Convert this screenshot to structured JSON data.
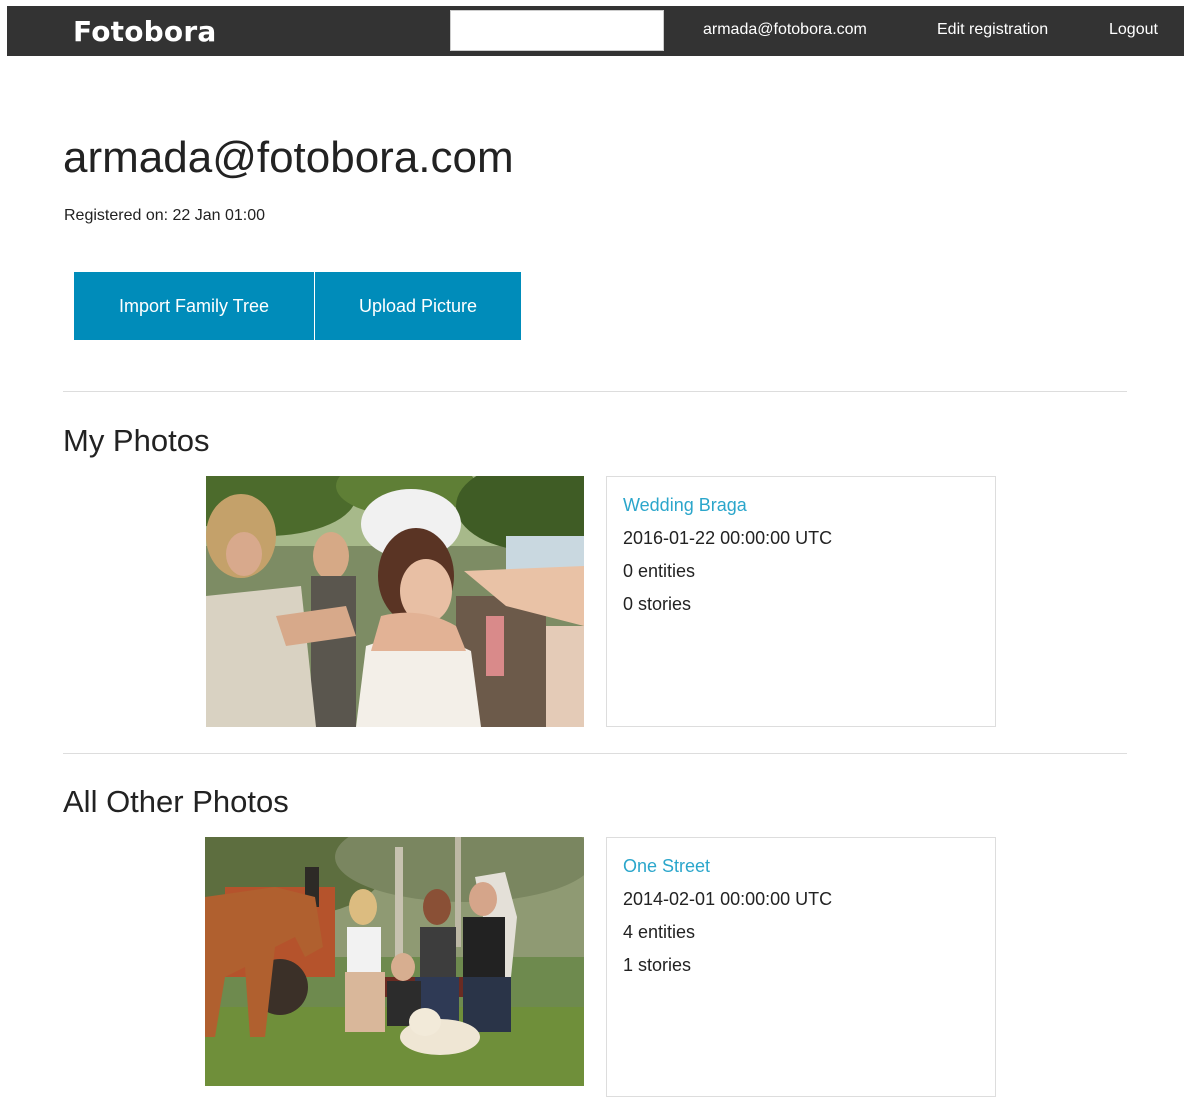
{
  "header": {
    "brand": "Fotobora",
    "search_value": "",
    "nav": {
      "email": "armada@fotobora.com",
      "edit_registration": "Edit registration",
      "logout": "Logout"
    },
    "background_color": "#333333"
  },
  "profile": {
    "title": "armada@fotobora.com",
    "registered": "Registered on: 22 Jan 01:00"
  },
  "actions": {
    "import_family_tree": "Import Family Tree",
    "upload_picture": "Upload Picture",
    "button_color": "#008cba"
  },
  "my_photos": {
    "heading": "My Photos",
    "items": [
      {
        "title": "Wedding Braga",
        "date": "2016-01-22 00:00:00 UTC",
        "entities": "0 entities",
        "stories": "0 stories"
      }
    ]
  },
  "other_photos": {
    "heading": "All Other Photos",
    "items": [
      {
        "title": "One Street",
        "date": "2014-02-01 00:00:00 UTC",
        "entities": "4 entities",
        "stories": "1 stories"
      }
    ]
  },
  "link_color": "#2ba6cb"
}
